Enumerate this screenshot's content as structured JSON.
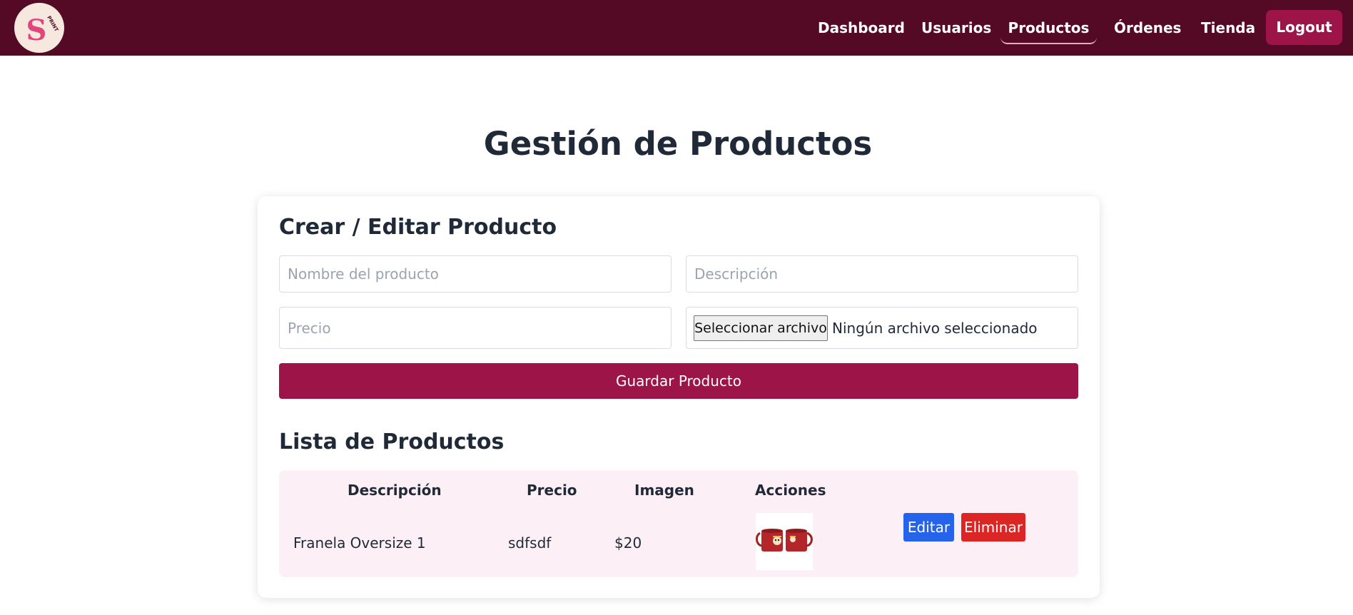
{
  "colors": {
    "navbar_bg": "#540a25",
    "accent": "#9c1448",
    "edit_button": "#2563eb",
    "delete_button": "#dc2626",
    "table_bg": "#fcf0f6",
    "logo_bg": "#f6e8df",
    "logo_mark": "#e0457b"
  },
  "header": {
    "logo": {
      "letter": "S",
      "small_text": "PRINT"
    },
    "nav": [
      {
        "label": "Dashboard",
        "active": false
      },
      {
        "label": "Usuarios",
        "active": false
      },
      {
        "label": "Productos",
        "active": true
      },
      {
        "label": "Órdenes",
        "active": false
      },
      {
        "label": "Tienda",
        "active": false
      }
    ],
    "logout_label": "Logout"
  },
  "page": {
    "title": "Gestión de Productos"
  },
  "form": {
    "title": "Crear / Editar Producto",
    "name_field": {
      "placeholder": "Nombre del producto",
      "value": ""
    },
    "description_field": {
      "placeholder": "Descripción",
      "value": ""
    },
    "price_field": {
      "placeholder": "Precio",
      "value": ""
    },
    "file": {
      "button_label": "Seleccionar archivo",
      "status": "Ningún archivo seleccionado"
    },
    "submit_label": "Guardar Producto"
  },
  "list": {
    "title": "Lista de Productos",
    "headers": [
      "Descripción",
      "Precio",
      "Imagen",
      "Acciones"
    ],
    "rows": [
      {
        "name": "Franela Oversize 1",
        "description": "sdfsdf",
        "price": "$20",
        "image_icon": "mugs-thumbnail",
        "edit_label": "Editar",
        "delete_label": "Eliminar"
      }
    ]
  }
}
